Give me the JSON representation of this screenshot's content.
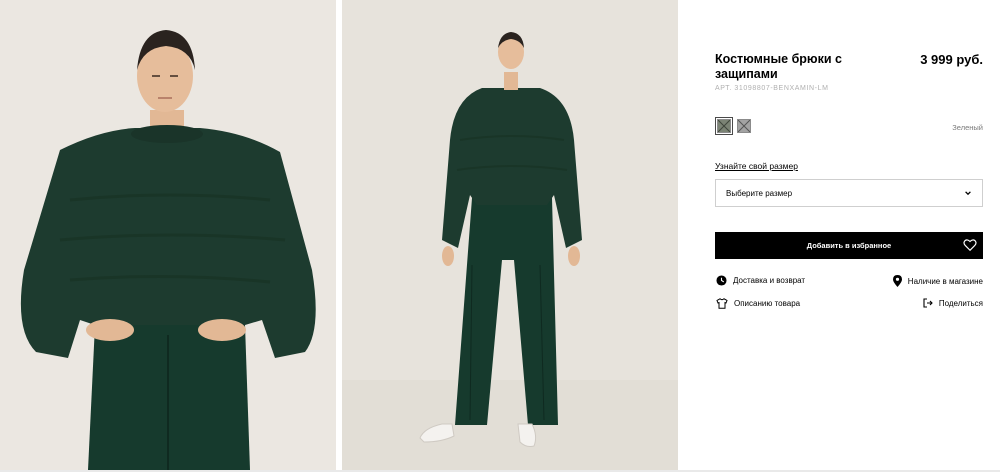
{
  "product": {
    "title": "Костюмные брюки с защипами",
    "price": "3 999 руб.",
    "sku": "АРТ. 31098807-BENXAMIN-LM",
    "color_name": "Зеленый",
    "swatches": [
      {
        "icon": "olive-swatch",
        "color": "#7b8374",
        "selected": true
      },
      {
        "icon": "gray-swatch",
        "color": "#a3a3a3",
        "selected": false
      }
    ]
  },
  "size": {
    "guide_label": "Узнайте свой размер",
    "select_placeholder": "Выберите размер"
  },
  "actions": {
    "add_to_favorites": "Добавить в избранное"
  },
  "links": {
    "delivery": "Доставка и возврат",
    "store_availability": "Наличие в магазине",
    "description": "Описанию товара",
    "share": "Поделиться"
  },
  "colors": {
    "sweater": "#1e3a2f",
    "trousers": "#173a2e",
    "background": "#ebe7e1",
    "button": "#000000"
  },
  "icons": [
    "clock-icon",
    "location-pin-icon",
    "tshirt-icon",
    "share-icon",
    "heart-icon",
    "chevron-down-icon"
  ]
}
